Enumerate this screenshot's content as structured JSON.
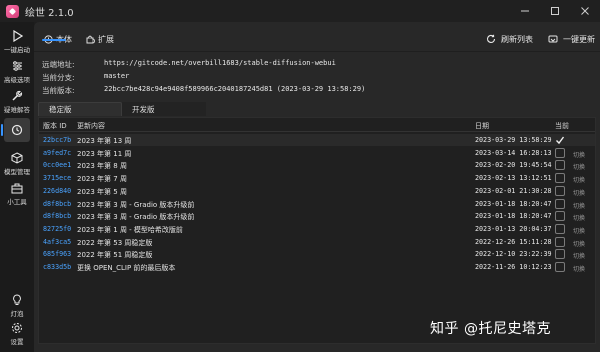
{
  "window": {
    "title": "绘世 2.1.0",
    "controls": [
      "minimize-icon",
      "maximize-icon",
      "close-icon"
    ]
  },
  "sidebar": {
    "items": [
      {
        "label": "一键启动",
        "icon": "play-icon"
      },
      {
        "label": "高级选项",
        "icon": "sliders-icon"
      },
      {
        "label": "疑难解答",
        "icon": "wrench-icon"
      },
      {
        "label": "",
        "icon": "clock-icon",
        "active": true
      },
      {
        "label": "模型管理",
        "icon": "cube-icon"
      },
      {
        "label": "小工具",
        "icon": "toolbox-icon"
      },
      {
        "label": "灯泡",
        "icon": "lightbulb-icon"
      },
      {
        "label": "设置",
        "icon": "gear-icon"
      }
    ],
    "accent": "#3794ff"
  },
  "header": {
    "tabs": [
      {
        "label": "本体",
        "icon": "clock-icon",
        "active": true
      },
      {
        "label": "扩展",
        "icon": "puzzle-icon",
        "active": false
      }
    ],
    "refresh_label": "刷新列表",
    "update_label": "一键更新"
  },
  "info": {
    "remote_label": "远端地址:",
    "remote_value": "https://gitcode.net/overbill1683/stable-diffusion-webui",
    "branch_label": "当前分支:",
    "branch_value": "master",
    "version_label": "当前版本:",
    "version_value": "22bcc7be428c94e9408f589966c2040187245d81 (2023-03-29 13:58:29)"
  },
  "subtabs": [
    {
      "label": "稳定版",
      "active": true
    },
    {
      "label": "开发版",
      "active": false
    }
  ],
  "table": {
    "headers": {
      "id": "版本 ID",
      "desc": "更新内容",
      "date": "日期",
      "current": "当前"
    },
    "rows": [
      {
        "id": "22bcc7b",
        "desc": "2023 年第 13 周",
        "date": "2023-03-29 13:58:29",
        "current": true,
        "action": ""
      },
      {
        "id": "a9fed7c",
        "desc": "2023 年第 11 周",
        "date": "2023-03-14 16:28:13",
        "current": false,
        "action": "切换"
      },
      {
        "id": "0cc0ee1",
        "desc": "2023 年第 8 周",
        "date": "2023-02-20 19:45:54",
        "current": false,
        "action": "切换"
      },
      {
        "id": "3715ece",
        "desc": "2023 年第 7 周",
        "date": "2023-02-13 13:12:51",
        "current": false,
        "action": "切换"
      },
      {
        "id": "226d840",
        "desc": "2023 年第 5 周",
        "date": "2023-02-01 21:30:28",
        "current": false,
        "action": "切换"
      },
      {
        "id": "d8f8bcb",
        "desc": "2023 年第 3 周 - Gradio 版本升级前",
        "date": "2023-01-18 18:20:47",
        "current": false,
        "action": "切换"
      },
      {
        "id": "d8f8bcb",
        "desc": "2023 年第 3 周 - Gradio 版本升级前",
        "date": "2023-01-18 18:20:47",
        "current": false,
        "action": "切换"
      },
      {
        "id": "82725f0",
        "desc": "2023 年第 1 周 - 模型哈希改版前",
        "date": "2023-01-13 20:04:37",
        "current": false,
        "action": "切换"
      },
      {
        "id": "4af3ca5",
        "desc": "2022 年第 53 周稳定版",
        "date": "2022-12-26 15:11:28",
        "current": false,
        "action": "切换"
      },
      {
        "id": "685f963",
        "desc": "2022 年第 51 周稳定版",
        "date": "2022-12-10 23:22:39",
        "current": false,
        "action": "切换"
      },
      {
        "id": "c833d5b",
        "desc": "更换 OPEN_CLIP 前的最后版本",
        "date": "2022-11-26 10:12:23",
        "current": false,
        "action": "切换"
      }
    ]
  },
  "watermark": "知乎 @托尼史塔克"
}
